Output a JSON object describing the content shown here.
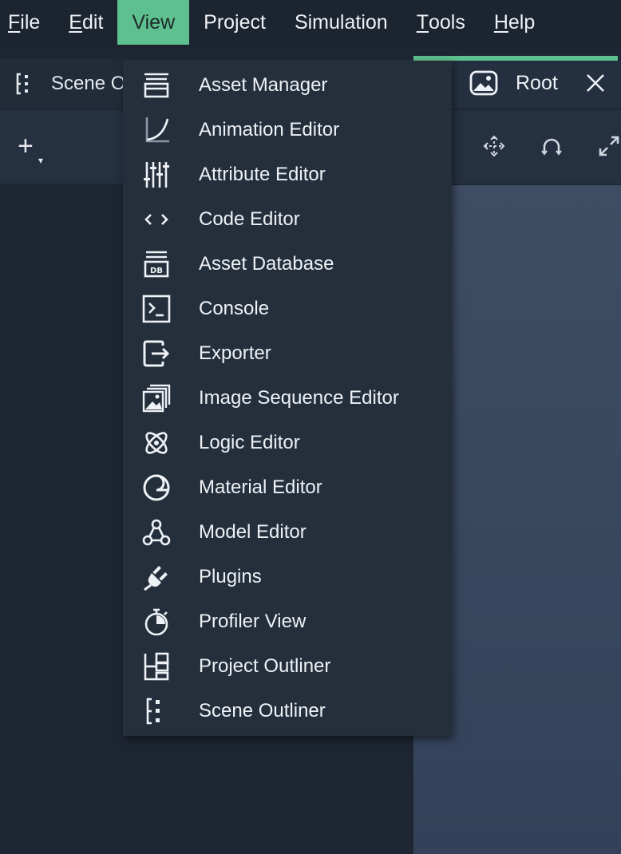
{
  "menubar": {
    "items": [
      {
        "label": "File",
        "mnemonic": "F",
        "rest": "ile"
      },
      {
        "label": "Edit",
        "mnemonic": "E",
        "rest": "dit"
      },
      {
        "label": "View",
        "mnemonic": "",
        "rest": "View"
      },
      {
        "label": "Project",
        "mnemonic": "",
        "rest": "Project"
      },
      {
        "label": "Simulation",
        "mnemonic": "",
        "rest": "Simulation"
      },
      {
        "label": "Tools",
        "mnemonic": "T",
        "rest": "ools"
      },
      {
        "label": "Help",
        "mnemonic": "H",
        "rest": "elp"
      }
    ],
    "active": "View"
  },
  "left_panel": {
    "title": "Scene Outliner",
    "icon": "scene-outliner-icon",
    "add_label": "+"
  },
  "right_panel": {
    "title": "Root",
    "icon": "image-icon",
    "close_icon": "close-icon",
    "tools": [
      "move-icon",
      "rotate-icon",
      "scale-icon"
    ]
  },
  "view_menu": {
    "items": [
      {
        "label": "Asset Manager",
        "icon": "asset-manager-icon"
      },
      {
        "label": "Animation Editor",
        "icon": "animation-curve-icon"
      },
      {
        "label": "Attribute Editor",
        "icon": "sliders-icon"
      },
      {
        "label": "Code Editor",
        "icon": "code-icon"
      },
      {
        "label": "Asset Database",
        "icon": "database-icon"
      },
      {
        "label": "Console",
        "icon": "terminal-icon"
      },
      {
        "label": "Exporter",
        "icon": "export-icon"
      },
      {
        "label": "Image Sequence Editor",
        "icon": "image-sequence-icon"
      },
      {
        "label": "Logic Editor",
        "icon": "atom-icon"
      },
      {
        "label": "Material Editor",
        "icon": "material-sphere-icon"
      },
      {
        "label": "Model Editor",
        "icon": "model-graph-icon"
      },
      {
        "label": "Plugins",
        "icon": "plug-icon"
      },
      {
        "label": "Profiler View",
        "icon": "stopwatch-icon"
      },
      {
        "label": "Project Outliner",
        "icon": "project-tree-icon"
      },
      {
        "label": "Scene Outliner",
        "icon": "scene-outliner-icon"
      }
    ]
  },
  "colors": {
    "accent": "#5fc08f",
    "menubar": "#1c2430",
    "panel": "#252f3c",
    "viewport": "#3e4d63"
  }
}
